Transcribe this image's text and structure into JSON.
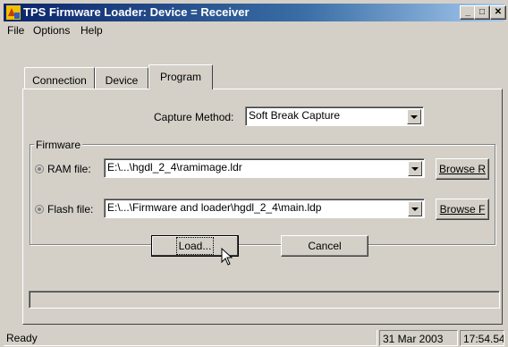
{
  "window": {
    "title": "TPS Firmware Loader:  Device = Receiver",
    "controls": {
      "minimize": "_",
      "maximize": "□",
      "close": "✕"
    }
  },
  "menu": [
    "File",
    "Options",
    "Help"
  ],
  "tabs": [
    {
      "label": "Connection",
      "active": false
    },
    {
      "label": "Device",
      "active": false
    },
    {
      "label": "Program",
      "active": true
    }
  ],
  "program": {
    "capture_label": "Capture Method:",
    "capture_value": "Soft Break Capture",
    "firmware_group": "Firmware",
    "ram_label": "RAM file:",
    "ram_value": "E:\\...\\hgdl_2_4\\ramimage.ldr",
    "browse_ram": "Browse R",
    "flash_label": "Flash file:",
    "flash_value": "E:\\...\\Firmware and loader\\hgdl_2_4\\main.ldp",
    "browse_flash": "Browse F",
    "load_button": "Load...",
    "cancel_button": "Cancel",
    "progress": 0
  },
  "status": {
    "text": "Ready",
    "date": "31 Mar 2003",
    "time": "17:54.54"
  },
  "colors": {
    "titlebar_start": "#0a246a",
    "titlebar_end": "#a6caf0",
    "face": "#d4d0c8"
  }
}
